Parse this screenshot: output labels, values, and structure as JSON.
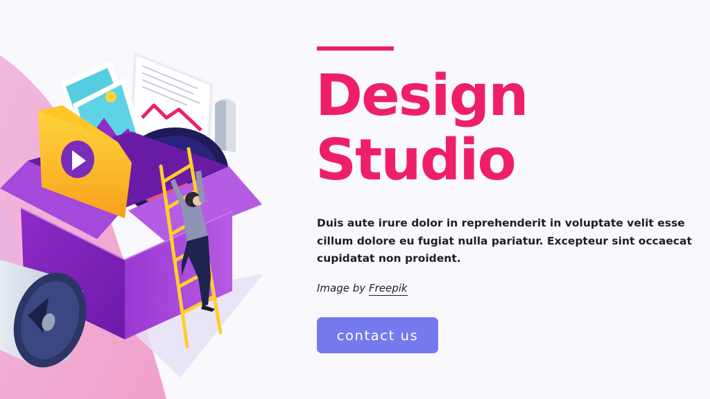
{
  "hero": {
    "title_line1": "Design",
    "title_line2": "Studio",
    "description": "Duis aute irure dolor in reprehenderit in voluptate velit esse cillum dolore eu fugiat nulla pariatur. Excepteur sint occaecat cupidatat non proident.",
    "credit_prefix": "Image by",
    "credit_link": "Freepik",
    "cta_label": "contact us"
  },
  "colors": {
    "accent": "#ee1f68",
    "button": "#7479ee",
    "background": "#f9f8fc",
    "text": "#1d1d26"
  },
  "illustration": {
    "icons": [
      "open-box-icon",
      "photo-card-icon",
      "folder-play-icon",
      "document-chart-icon",
      "vinyl-record-icon",
      "ladder-icon",
      "climbing-person-icon",
      "megaphone-icon"
    ]
  }
}
